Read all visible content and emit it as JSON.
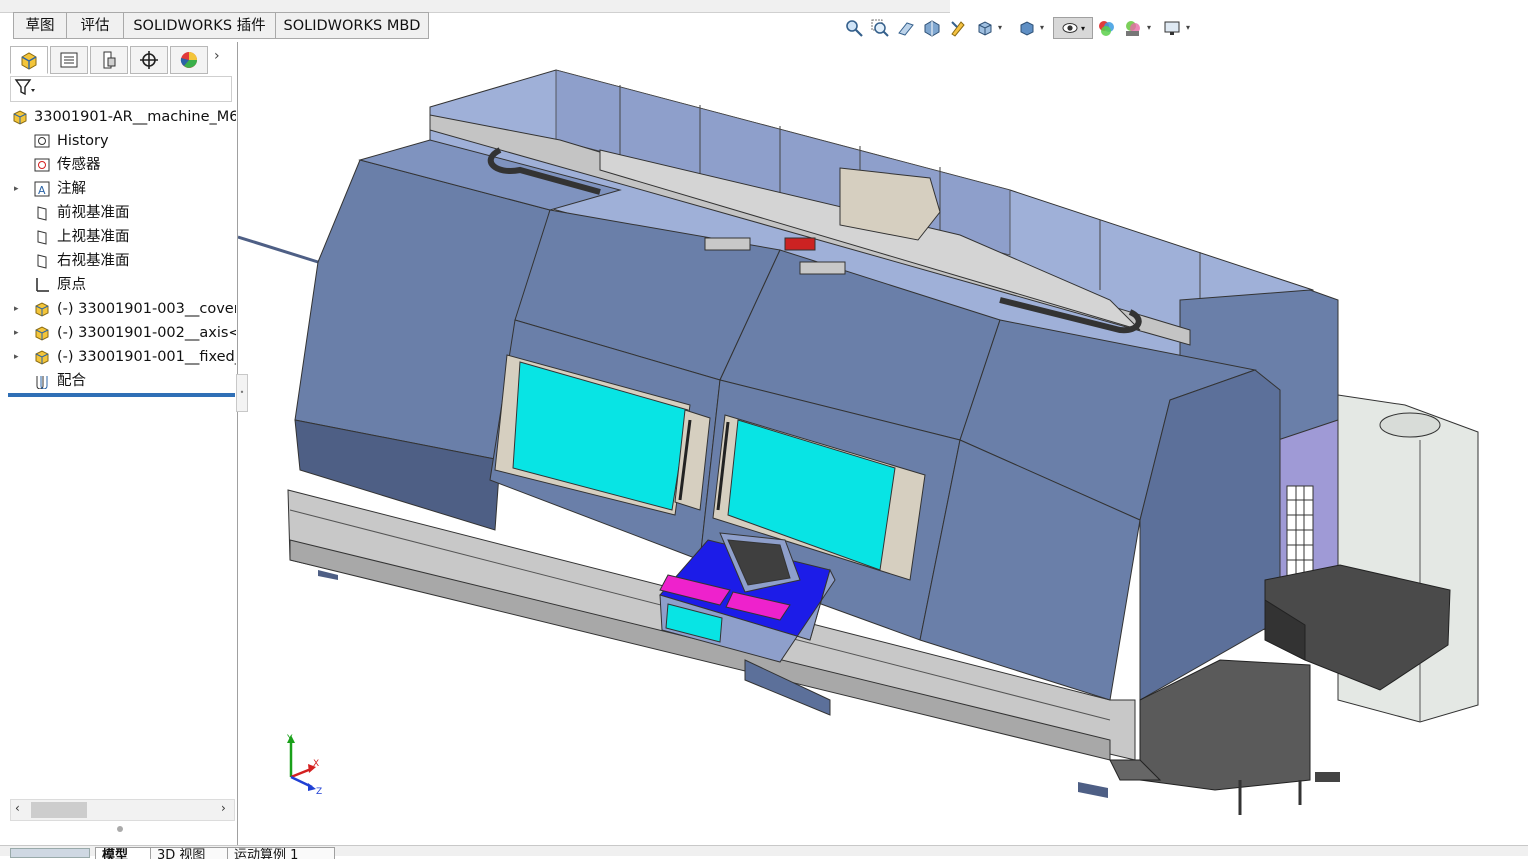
{
  "command_tabs": [
    "草图",
    "评估",
    "SOLIDWORKS 插件",
    "SOLIDWORKS MBD"
  ],
  "hud_icons": [
    "zoom-to-fit-icon",
    "zoom-area-icon",
    "previous-view-icon",
    "section-view-icon",
    "dynamic-annotation-icon",
    "view-orientation-icon",
    "display-style-icon",
    "hide-show-items-icon",
    "edit-appearance-icon",
    "apply-scene-icon",
    "view-settings-icon"
  ],
  "panel_tabs": [
    "feature-manager-icon",
    "property-manager-icon",
    "configuration-manager-icon",
    "dimxpert-manager-icon",
    "display-manager-icon"
  ],
  "tree": {
    "root": "33001901-AR__machine_M6",
    "items": [
      {
        "label": "History",
        "icon": "history-icon",
        "expandable": false
      },
      {
        "label": "传感器",
        "icon": "sensor-icon",
        "expandable": false
      },
      {
        "label": "注解",
        "icon": "annotation-icon",
        "expandable": true
      },
      {
        "label": "前视基准面",
        "icon": "plane-icon",
        "expandable": false
      },
      {
        "label": "上视基准面",
        "icon": "plane-icon",
        "expandable": false
      },
      {
        "label": "右视基准面",
        "icon": "plane-icon",
        "expandable": false
      },
      {
        "label": "原点",
        "icon": "origin-icon",
        "expandable": false
      },
      {
        "label": "(-) 33001901-003__cover",
        "icon": "subassembly-icon",
        "expandable": true
      },
      {
        "label": "(-) 33001901-002__axis<",
        "icon": "subassembly-icon",
        "expandable": true
      },
      {
        "label": "(-) 33001901-001__fixed_",
        "icon": "subassembly-icon",
        "expandable": true
      },
      {
        "label": "配合",
        "icon": "mates-icon",
        "expandable": false
      }
    ]
  },
  "bottom_tabs": [
    "模型",
    "3D 视图",
    "运动算例 1"
  ],
  "triad": {
    "x": "X",
    "y": "Y",
    "z": "Z"
  },
  "colors": {
    "housing": "#6a7fa9",
    "housing_dark": "#4e5f85",
    "window_glass": "#08e4e4",
    "panel_magenta": "#ee22cc",
    "panel_blue": "#1c1ce8",
    "chip_conveyor": "#4a4a4a",
    "rollback_bar": "#2f6fb6"
  }
}
